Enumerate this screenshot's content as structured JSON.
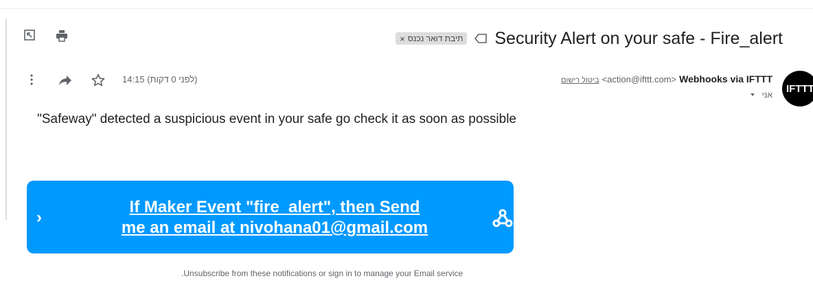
{
  "subject": {
    "title": "Security Alert on your safe - Fire_alert",
    "label": "תיבת דואר נכנס",
    "label_remove_glyph": "×"
  },
  "toolbar": {
    "expand_icon": "expand-icon",
    "print_icon": "print-icon",
    "important_icon": "importance-marker-icon"
  },
  "sender": {
    "avatar_text": "IFTTT",
    "name": "Webhooks via IFTTT",
    "email": "<action@ifttt.com>",
    "unsubscribe": "ביטול רישום",
    "recipient": "אני"
  },
  "meta": {
    "time": "14:15 (לפני 0 דקות)",
    "more_icon": "more-vert-icon",
    "forward_icon": "forward-icon",
    "star_icon": "star-icon"
  },
  "body": {
    "text": "Safeway\" detected a suspicious event in your safe go check it as soon as possible\""
  },
  "applet": {
    "line1": "If Maker Event \"fire_alert\", then Send",
    "line2": "me an email at nivohana01@gmail.com",
    "chevron": "›",
    "icon": "webhooks-icon",
    "bg_color": "#0099ff"
  },
  "footer": {
    "text": "Unsubscribe from these notifications or sign in to manage your Email service."
  }
}
